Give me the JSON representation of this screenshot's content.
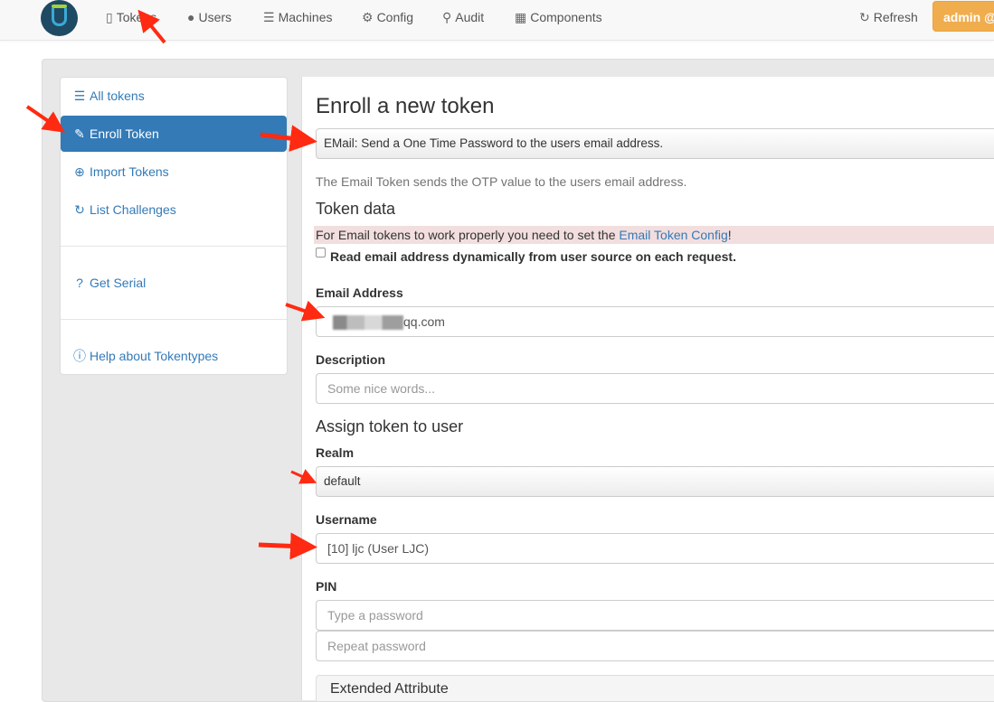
{
  "navbar": {
    "items": [
      {
        "label": "Tokens",
        "icon": "mobile-icon"
      },
      {
        "label": "Users",
        "icon": "user-icon"
      },
      {
        "label": "Machines",
        "icon": "server-icon"
      },
      {
        "label": "Config",
        "icon": "gear-icon"
      },
      {
        "label": "Audit",
        "icon": "search-icon"
      },
      {
        "label": "Components",
        "icon": "calendar-icon"
      }
    ],
    "refresh_label": "Refresh",
    "admin_label": "admin @"
  },
  "sidebar": {
    "items": [
      {
        "label": "All tokens",
        "icon": "list-icon"
      },
      {
        "label": "Enroll Token",
        "icon": "edit-icon"
      },
      {
        "label": "Import Tokens",
        "icon": "upload-icon"
      },
      {
        "label": "List Challenges",
        "icon": "refresh-icon"
      },
      {
        "label": "Get Serial",
        "icon": "question-icon"
      },
      {
        "label": "Help about Tokentypes",
        "icon": "info-icon"
      }
    ]
  },
  "main": {
    "title": "Enroll a new token",
    "token_type": "EMail: Send a One Time Password to the users email address.",
    "token_help": "The Email Token sends the OTP value to the users email address.",
    "token_data_heading": "Token data",
    "alert_text": "For Email tokens to work properly you need to set the ",
    "alert_link": "Email Token Config",
    "alert_end": "!",
    "dynamic_email_label": "Read email address dynamically from user source on each request.",
    "email_label": "Email Address",
    "email_value_suffix": "qq.com",
    "description_label": "Description",
    "description_placeholder": "Some nice words...",
    "assign_heading": "Assign token to user",
    "realm_label": "Realm",
    "realm_value": "default",
    "username_label": "Username",
    "username_value": "[10] ljc (User LJC)",
    "pin_label": "PIN",
    "pin_placeholder": "Type a password",
    "pin_repeat_placeholder": "Repeat password",
    "extended_heading": "Extended Attribute"
  },
  "colors": {
    "primary": "#337ab7",
    "admin_button": "#f0ad4e",
    "alert_bg": "#f2dede",
    "arrow": "#ff2a12"
  }
}
